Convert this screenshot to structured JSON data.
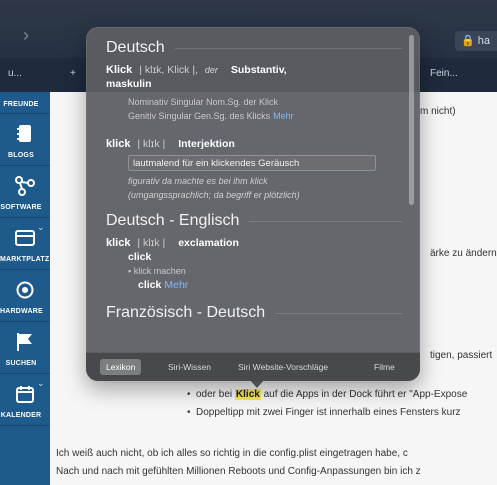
{
  "browser": {
    "url_fragment": "ha"
  },
  "toolbar": {
    "items": [
      {
        "label": "u..."
      },
      {
        "label": "Fein..."
      }
    ]
  },
  "sidebar": {
    "items": [
      {
        "label": "FREUNDE",
        "icon": "people-icon"
      },
      {
        "label": "BLOGS",
        "icon": "notebook-icon"
      },
      {
        "label": "SOFTWARE",
        "icon": "nodes-icon"
      },
      {
        "label": "MARKTPLATZ",
        "icon": "window-icon"
      },
      {
        "label": "HARDWARE",
        "icon": "target-icon"
      },
      {
        "label": "SUCHEN",
        "icon": "flag-icon"
      },
      {
        "label": "KALENDER",
        "icon": "calendar-icon"
      }
    ]
  },
  "page": {
    "snippet_1": "m nicht)",
    "snippet_2": "ärke zu ändern,",
    "snippet_3": "tigen, passiert",
    "bullet_1_prefix": "oder bei ",
    "bullet_1_highlight": "Klick",
    "bullet_1_suffix": " auf die Apps in der Dock führt er \"App-Expose",
    "bullet_2": "Doppeltipp mit zwei Finger ist innerhalb eines Fensters kurz",
    "para_1": "Ich weiß auch nicht, ob ich alles so richtig in die config.plist eingetragen habe, c",
    "para_2": "Nach und nach mit gefühlten Millionen Reboots und Config-Anpassungen bin ich z"
  },
  "popover": {
    "sections": [
      {
        "heading": "Deutsch",
        "entry1": {
          "headword": "Klick",
          "pron": "| klɪk, Klick |,",
          "gram": "der",
          "pos": "Substantiv,",
          "pos_cont": "maskulin",
          "sub1": "Nominativ Singular Nom.Sg. der Klick",
          "sub2": "Genitiv Singular Gen.Sg. des Klicks",
          "more": "Mehr"
        },
        "entry2": {
          "headword": "klick",
          "pron": "| klɪk |",
          "pos": "Interjektion",
          "meaning": "lautmalend für ein klickendes Geräusch",
          "ex1_a": "figurativ",
          "ex1_b": "da machte es bei ihm klick",
          "ex2_a": "(umgangssprachlich;",
          "ex2_b": "da begriff er plötzlich)"
        }
      },
      {
        "heading": "Deutsch - Englisch",
        "entry1": {
          "headword": "klick",
          "pron": "| klɪk |",
          "pos": "exclamation",
          "trans": "click",
          "phrase": "klick machen",
          "phrase_trans": "click",
          "more": "Mehr"
        }
      },
      {
        "heading": "Französisch - Deutsch"
      }
    ],
    "tabs": [
      {
        "label": "Lexikon",
        "active": true
      },
      {
        "label": "Siri-Wissen",
        "active": false
      },
      {
        "label": "Siri Website-Vorschläge",
        "active": false
      },
      {
        "label": "Filme",
        "active": false
      }
    ]
  }
}
